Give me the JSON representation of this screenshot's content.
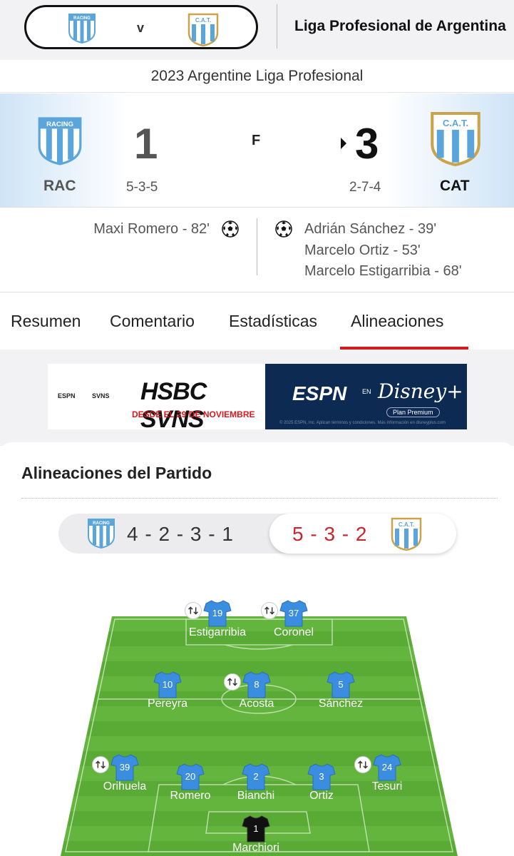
{
  "header": {
    "league": "Liga Profesional de Argentina",
    "vs": "v",
    "season": "2023 Argentine Liga Profesional"
  },
  "crests": {
    "racing_text": "RACING",
    "cat_text": "C.A.T."
  },
  "scoreboard": {
    "home": {
      "abbr": "RAC",
      "score": "1",
      "formation": "5-3-5"
    },
    "away": {
      "abbr": "CAT",
      "score": "3",
      "formation": "2-7-4"
    },
    "status": "F"
  },
  "scorers": {
    "home": [
      "Maxi Romero - 82'"
    ],
    "away": [
      "Adrián Sánchez - 39'",
      "Marcelo Ortiz - 53'",
      "Marcelo Estigarribia - 68'"
    ]
  },
  "tabs": [
    "Resumen",
    "Comentario",
    "Estadísticas",
    "Alineaciones"
  ],
  "active_tab": "Alineaciones",
  "ad": {
    "brand_left_1": "ESPN",
    "brand_left_2": "SVNS",
    "title": "HSBC SVNS",
    "subtitle": "DESDE EL 29 DE NOVIEMBRE",
    "espn": "ESPN",
    "en": "EN",
    "disney": "Disney+",
    "plan": "Plan Premium",
    "legal": "© 2025 ESPN, Inc. Aplican términos y condiciones. Más información en disneyplus.com"
  },
  "lineups": {
    "title": "Alineaciones del Partido",
    "home_formation": "4 - 2 - 3 - 1",
    "away_formation": "5 - 3 - 2",
    "players": [
      {
        "num": "19",
        "name": "Estigarribia",
        "sub": true
      },
      {
        "num": "37",
        "name": "Coronel",
        "sub": true
      },
      {
        "num": "10",
        "name": "Pereyra",
        "sub": false
      },
      {
        "num": "8",
        "name": "Acosta",
        "sub": true
      },
      {
        "num": "5",
        "name": "Sánchez",
        "sub": false
      },
      {
        "num": "39",
        "name": "Orihuela",
        "sub": true
      },
      {
        "num": "20",
        "name": "Romero",
        "sub": false
      },
      {
        "num": "2",
        "name": "Bianchi",
        "sub": false
      },
      {
        "num": "3",
        "name": "Ortiz",
        "sub": false
      },
      {
        "num": "24",
        "name": "Tesuri",
        "sub": true
      },
      {
        "num": "1",
        "name": "Marchiori",
        "sub": false
      }
    ]
  },
  "colors": {
    "accent_red": "#d71920",
    "cat_blue": "#5aa6dc",
    "pitch_green": "#5fb23a",
    "jersey_blue": "#3b8de0"
  }
}
